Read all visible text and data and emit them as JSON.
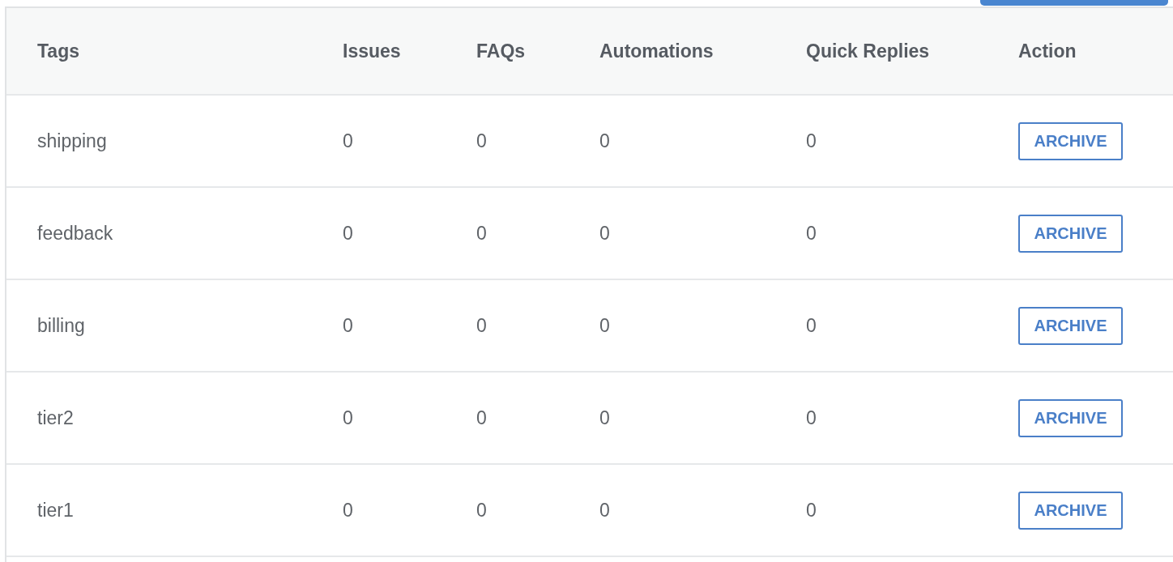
{
  "table": {
    "columns": [
      "Tags",
      "Issues",
      "FAQs",
      "Automations",
      "Quick Replies",
      "Action"
    ],
    "rows": [
      {
        "tag": "shipping",
        "issues": "0",
        "faqs": "0",
        "automations": "0",
        "quick_replies": "0",
        "action": "ARCHIVE"
      },
      {
        "tag": "feedback",
        "issues": "0",
        "faqs": "0",
        "automations": "0",
        "quick_replies": "0",
        "action": "ARCHIVE"
      },
      {
        "tag": "billing",
        "issues": "0",
        "faqs": "0",
        "automations": "0",
        "quick_replies": "0",
        "action": "ARCHIVE"
      },
      {
        "tag": "tier2",
        "issues": "0",
        "faqs": "0",
        "automations": "0",
        "quick_replies": "0",
        "action": "ARCHIVE"
      },
      {
        "tag": "tier1",
        "issues": "0",
        "faqs": "0",
        "automations": "0",
        "quick_replies": "0",
        "action": "ARCHIVE"
      }
    ]
  }
}
